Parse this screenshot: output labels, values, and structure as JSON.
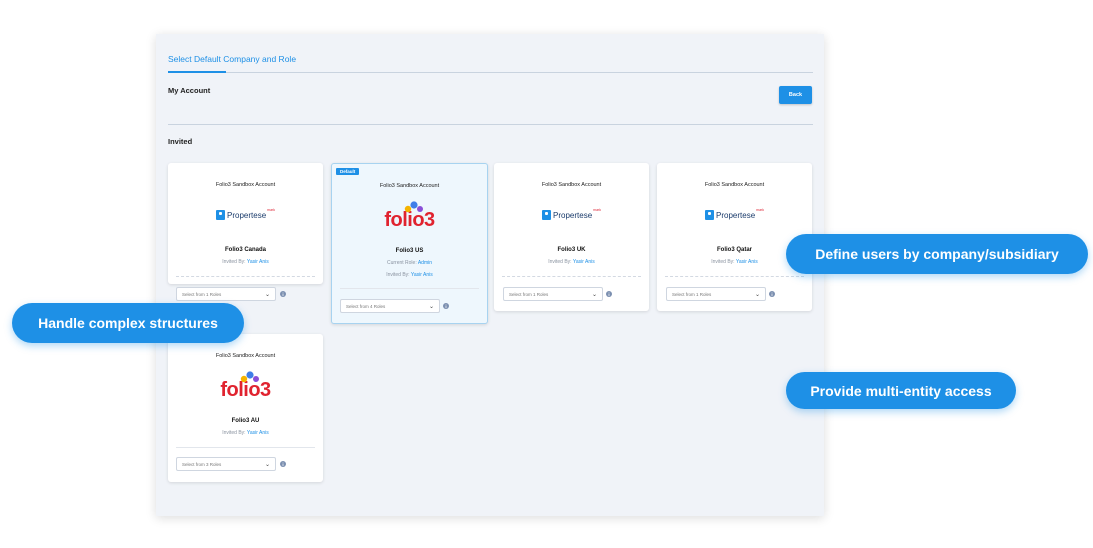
{
  "tab": {
    "label": "Select Default Company and Role"
  },
  "my_account": {
    "title": "My Account",
    "back_label": "Back"
  },
  "invited": {
    "title": "Invited"
  },
  "colors": {
    "accent": "#1e90e6",
    "folio_red": "#e0232f"
  },
  "cards": [
    {
      "account": "Folio3 Sandbox Account",
      "logo": "propertese",
      "logo_text": "Propertese",
      "logo_sup": "mark",
      "company": "Folio3 Canada",
      "invited_by_label": "Invited By:",
      "invited_by": "Yasir Anis",
      "select": "Select from 1 Roles"
    },
    {
      "badge": "Default",
      "account": "Folio3 Sandbox Account",
      "logo": "folio3",
      "logo_text": "folio3",
      "company": "Folio3 US",
      "current_role_label": "Current Role:",
      "current_role": "Admin",
      "invited_by_label": "Invited By:",
      "invited_by": "Yasir Anis",
      "select": "Select from 4 Roles"
    },
    {
      "account": "Folio3 Sandbox Account",
      "logo": "propertese",
      "logo_text": "Propertese",
      "logo_sup": "mark",
      "company": "Folio3 UK",
      "invited_by_label": "Invited By:",
      "invited_by": "Yasir Anis",
      "select": "Select from 1 Roles"
    },
    {
      "account": "Folio3 Sandbox Account",
      "logo": "propertese",
      "logo_text": "Propertese",
      "logo_sup": "mark",
      "company": "Folio3 Qatar",
      "invited_by_label": "Invited By:",
      "invited_by": "Yasir Anis",
      "select": "Select from 1 Roles"
    },
    {
      "account": "Folio3 Sandbox Account",
      "logo": "folio3",
      "logo_text": "folio3",
      "company": "Folio3 AU",
      "invited_by_label": "Invited By:",
      "invited_by": "Yasir Anis",
      "select": "Select from 3 Roles"
    }
  ],
  "callouts": {
    "define_users": "Define users by company/subsidiary",
    "handle_complex": "Handle complex structures",
    "multi_entity": "Provide multi-entity access"
  }
}
